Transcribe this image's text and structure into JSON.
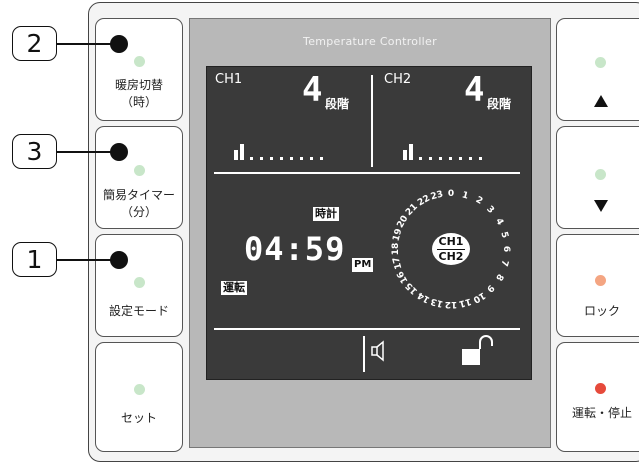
{
  "panel": {
    "title": "Temperature Controller"
  },
  "callouts": [
    {
      "number": "2"
    },
    {
      "number": "3"
    },
    {
      "number": "1"
    }
  ],
  "left_buttons": [
    {
      "line1": "暖房切替",
      "line2": "（時）",
      "led_color": "#c8e6c9"
    },
    {
      "line1": "簡易タイマー",
      "line2": "（分）",
      "led_color": "#c8e6c9"
    },
    {
      "line1": "設定モード",
      "line2": "",
      "led_color": "#c8e6c9"
    },
    {
      "line1": "セット",
      "line2": "",
      "led_color": "#c8e6c9"
    }
  ],
  "right_buttons": [
    {
      "label": "▲",
      "icon": "up-triangle-icon",
      "led_color": "#c8e6c9"
    },
    {
      "label": "▼",
      "icon": "down-triangle-icon",
      "led_color": "#c8e6c9"
    },
    {
      "label": "ロック",
      "icon": "",
      "led_color": "#f4a582"
    },
    {
      "label": "運転・停止",
      "icon": "",
      "led_color": "#e64a3b"
    }
  ],
  "display": {
    "ch1": {
      "label": "CH1",
      "level": "4",
      "level_unit": "段階"
    },
    "ch2": {
      "label": "CH2",
      "level": "4",
      "level_unit": "段階"
    },
    "clock_label": "時計",
    "time": "04:59",
    "ampm": "PM",
    "run_label": "運転",
    "channel_select_top": "CH1",
    "channel_select_bottom": "CH2",
    "dial_hours": [
      "0",
      "1",
      "2",
      "3",
      "4",
      "5",
      "6",
      "7",
      "8",
      "9",
      "10",
      "11",
      "12",
      "13",
      "14",
      "15",
      "16",
      "17",
      "18",
      "19",
      "20",
      "21",
      "22",
      "23"
    ],
    "speaker_icon": "speaker-icon",
    "lock_icon": "unlocked-padlock-icon"
  }
}
